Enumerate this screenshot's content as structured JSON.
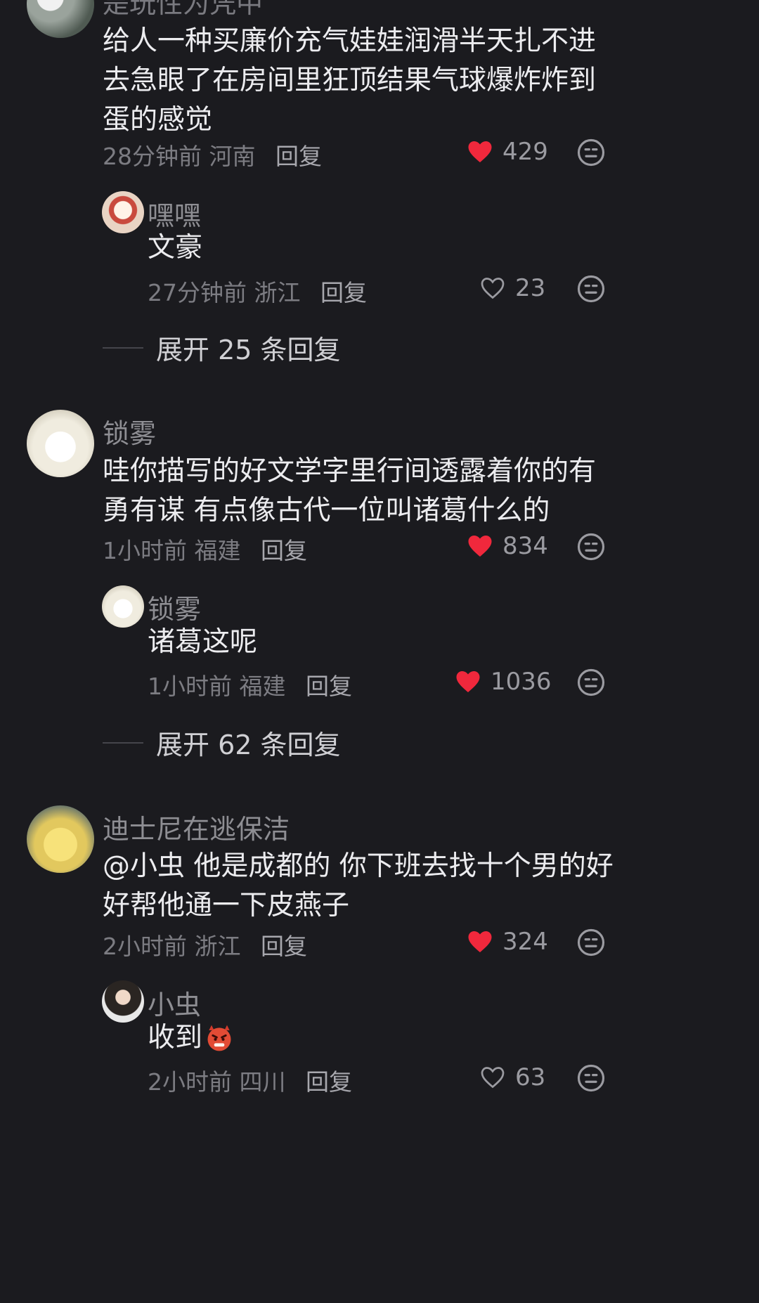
{
  "threads": [
    {
      "comment": {
        "username": "是玩性为凭中",
        "text": "给人一种买廉价充气娃娃润滑半天扎不进去急眼了在房间里狂顶结果气球爆炸炸到蛋的感觉",
        "time": "28分钟前",
        "location": "河南",
        "reply_label": "回复",
        "likes": "429",
        "liked": true
      },
      "reply": {
        "username": "嘿嘿",
        "text": "文豪",
        "time": "27分钟前",
        "location": "浙江",
        "reply_label": "回复",
        "likes": "23",
        "liked": false
      },
      "expand_label": "展开 25 条回复"
    },
    {
      "comment": {
        "username": "锁雾",
        "text": "哇你描写的好文学字里行间透露着你的有勇有谋 有点像古代一位叫诸葛什么的",
        "time": "1小时前",
        "location": "福建",
        "reply_label": "回复",
        "likes": "834",
        "liked": true
      },
      "reply": {
        "username": "锁雾",
        "text": "诸葛这呢",
        "time": "1小时前",
        "location": "福建",
        "reply_label": "回复",
        "likes": "1036",
        "liked": true
      },
      "expand_label": "展开 62 条回复"
    },
    {
      "comment": {
        "username": "迪士尼在逃保洁",
        "text": "@小虫  他是成都的 你下班去找十个男的好好帮他通一下皮燕子",
        "time": "2小时前",
        "location": "浙江",
        "reply_label": "回复",
        "likes": "324",
        "liked": true
      },
      "reply": {
        "username": "小虫",
        "text": "收到",
        "emoji": "angry-devil-emoji",
        "time": "2小时前",
        "location": "四川",
        "reply_label": "回复",
        "likes": "63",
        "liked": false
      }
    }
  ],
  "colors": {
    "background": "#1b1b1f",
    "heart_active": "#f0283c",
    "secondary_text": "#7c7c82"
  }
}
